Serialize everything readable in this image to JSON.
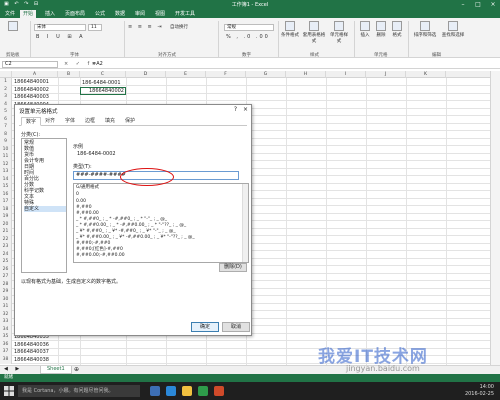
{
  "window": {
    "title": "工作簿1 - Excel",
    "quick_access": "▣ ↶ ↷ ⊟"
  },
  "tabs": [
    "文件",
    "开始",
    "插入",
    "页面布局",
    "公式",
    "数据",
    "审阅",
    "视图",
    "开发工具"
  ],
  "ribbon": {
    "font_name": "宋体",
    "font_size": "11",
    "wrap_text": "自动换行",
    "number_format": "常规",
    "groups": [
      "剪贴板",
      "字体",
      "对齐方式",
      "数字",
      "样式",
      "单元格",
      "编辑"
    ],
    "big_buttons": [
      "条件格式",
      "套用表格格式",
      "单元格样式",
      "插入",
      "删除",
      "格式",
      "排序和筛选",
      "查找和选择"
    ]
  },
  "formula_bar": {
    "name_box": "C2",
    "icons": "× ✓ fx",
    "value": "=A2"
  },
  "columns": [
    "A",
    "B",
    "C",
    "D",
    "E",
    "F",
    "G",
    "H",
    "I",
    "J",
    "K"
  ],
  "rows": [
    {
      "num": "1",
      "a": "18664840001"
    },
    {
      "num": "2",
      "a": "18664840002"
    },
    {
      "num": "3",
      "a": "18664840003"
    },
    {
      "num": "4",
      "a": "18664840004"
    },
    {
      "num": "5",
      "a": "18664840005"
    },
    {
      "num": "6",
      "a": ""
    },
    {
      "num": "7",
      "a": ""
    },
    {
      "num": "8",
      "a": ""
    },
    {
      "num": "9",
      "a": ""
    },
    {
      "num": "10",
      "a": ""
    },
    {
      "num": "11",
      "a": ""
    },
    {
      "num": "12",
      "a": ""
    },
    {
      "num": "13",
      "a": ""
    },
    {
      "num": "14",
      "a": ""
    },
    {
      "num": "15",
      "a": ""
    },
    {
      "num": "16",
      "a": ""
    },
    {
      "num": "17",
      "a": ""
    },
    {
      "num": "18",
      "a": ""
    },
    {
      "num": "19",
      "a": ""
    },
    {
      "num": "20",
      "a": ""
    },
    {
      "num": "21",
      "a": ""
    },
    {
      "num": "22",
      "a": ""
    },
    {
      "num": "23",
      "a": ""
    },
    {
      "num": "24",
      "a": ""
    },
    {
      "num": "25",
      "a": ""
    },
    {
      "num": "26",
      "a": ""
    },
    {
      "num": "27",
      "a": ""
    },
    {
      "num": "28",
      "a": ""
    },
    {
      "num": "29",
      "a": ""
    },
    {
      "num": "30",
      "a": ""
    },
    {
      "num": "31",
      "a": ""
    },
    {
      "num": "32",
      "a": ""
    },
    {
      "num": "33",
      "a": ""
    },
    {
      "num": "34",
      "a": ""
    },
    {
      "num": "35",
      "a": "18664840035"
    },
    {
      "num": "36",
      "a": "18664840036"
    },
    {
      "num": "37",
      "a": "18664840037"
    },
    {
      "num": "38",
      "a": "18664840038"
    }
  ],
  "cells": {
    "c1": "186-6484-0001",
    "c2": "18664840002"
  },
  "dialog": {
    "title": "设置单元格格式",
    "help": "?",
    "close": "×",
    "tabs": [
      "数字",
      "对齐",
      "字体",
      "边框",
      "填充",
      "保护"
    ],
    "category_label": "分类(C):",
    "categories": [
      "常规",
      "数值",
      "货币",
      "会计专用",
      "日期",
      "时间",
      "百分比",
      "分数",
      "科学记数",
      "文本",
      "特殊",
      "自定义"
    ],
    "selected_category": "自定义",
    "sample_label": "示例",
    "sample_value": "186-6484-0002",
    "type_label": "类型(T):",
    "type_value": "###-####-####",
    "formats": [
      "G/通用格式",
      "0",
      "0.00",
      "#,##0",
      "#,##0.00",
      "_ * #,##0_ ; _ * -#,##0_ ; _ * \"-\"_ ; _ @_",
      "_ * #,##0.00_ ; _ * -#,##0.00_ ; _ * \"-\"??_ ; _ @_",
      "_ ¥* #,##0_ ; _ ¥* -#,##0_ ; _ ¥* \"-\"_ ; _ @_",
      "_ ¥* #,##0.00_ ; _ ¥* -#,##0.00_ ; _ ¥* \"-\"??_ ; _ @_",
      "#,##0;-#,##0",
      "#,##0;[红色]-#,##0",
      "#,##0.00;-#,##0.00"
    ],
    "delete_button": "删除(D)",
    "description": "以现有格式为基础，生成自定义的数字格式。",
    "ok_button": "确定",
    "cancel_button": "取消"
  },
  "sheet_tab": "Sheet1",
  "status": "就绪",
  "taskbar": {
    "search_placeholder": "我是 Cortana，小娜。有问题尽管问我。",
    "time": "14:00",
    "date": "2016-02-25"
  },
  "watermark": {
    "text": "我爱IT技术网",
    "url": "jingyan.baidu.com"
  }
}
